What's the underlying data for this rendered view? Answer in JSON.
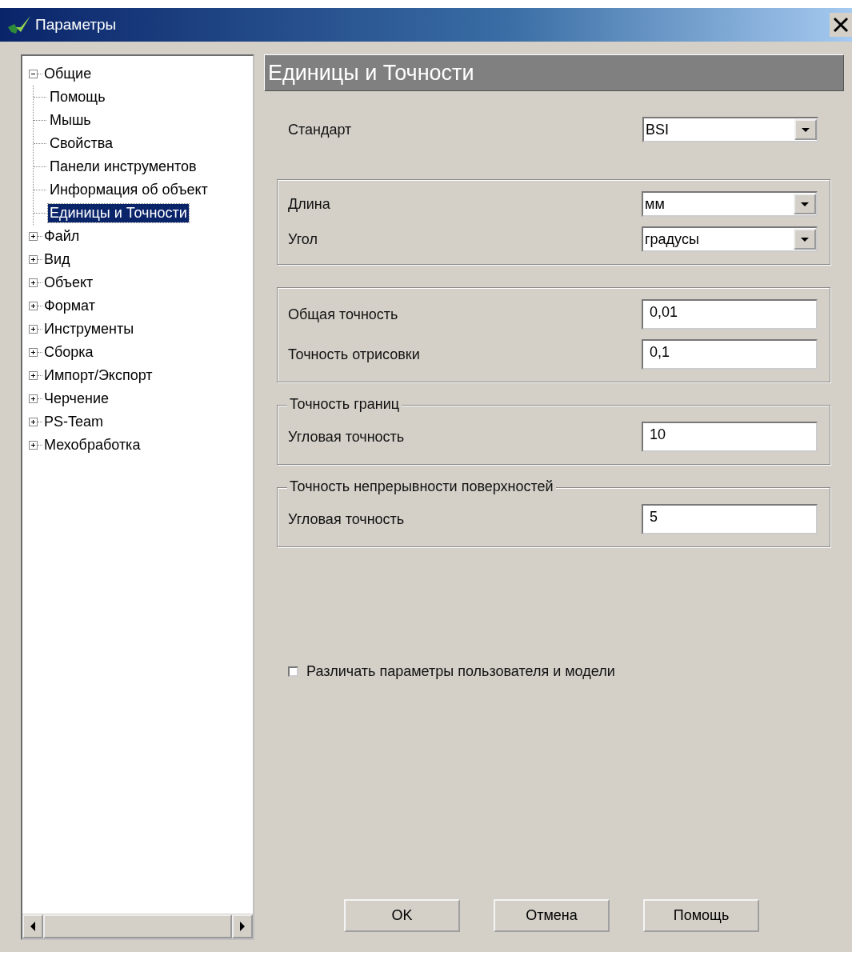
{
  "window": {
    "title": "Параметры"
  },
  "tree": {
    "items": [
      {
        "label": "Общие",
        "expanded": true,
        "selected": false,
        "children": [
          {
            "label": "Помощь",
            "selected": false
          },
          {
            "label": "Мышь",
            "selected": false
          },
          {
            "label": "Свойства",
            "selected": false
          },
          {
            "label": "Панели инструментов",
            "selected": false
          },
          {
            "label": "Информация об объект",
            "selected": false
          },
          {
            "label": "Единицы и Точности",
            "selected": true
          }
        ]
      },
      {
        "label": "Файл",
        "expanded": false,
        "selected": false
      },
      {
        "label": "Вид",
        "expanded": false,
        "selected": false
      },
      {
        "label": "Объект",
        "expanded": false,
        "selected": false
      },
      {
        "label": "Формат",
        "expanded": false,
        "selected": false
      },
      {
        "label": "Инструменты",
        "expanded": false,
        "selected": false
      },
      {
        "label": "Сборка",
        "expanded": false,
        "selected": false
      },
      {
        "label": "Импорт/Экспорт",
        "expanded": false,
        "selected": false
      },
      {
        "label": "Черчение",
        "expanded": false,
        "selected": false
      },
      {
        "label": "PS-Team",
        "expanded": false,
        "selected": false
      },
      {
        "label": "Мехобработка",
        "expanded": false,
        "selected": false
      }
    ]
  },
  "panel": {
    "title": "Единицы и Точности",
    "standard": {
      "label": "Стандарт",
      "kind": "combo",
      "value": "BSI"
    },
    "groups": [
      {
        "rows": [
          {
            "label": "Длина",
            "kind": "combo",
            "value": "мм"
          },
          {
            "label": "Угол",
            "kind": "combo",
            "value": "градусы"
          }
        ]
      },
      {
        "rows": [
          {
            "label": "Общая точность",
            "kind": "input",
            "value": "0,01"
          },
          {
            "label": "Точность отрисовки",
            "kind": "input",
            "value": "0,1"
          }
        ]
      },
      {
        "legend": "Точность границ",
        "rows": [
          {
            "label": "Угловая точность",
            "kind": "input",
            "value": "10"
          }
        ]
      },
      {
        "legend": "Точность непрерывности поверхностей",
        "rows": [
          {
            "label": "Угловая точность",
            "kind": "input",
            "value": "5"
          }
        ]
      }
    ],
    "checkbox": {
      "label": "Различать параметры пользователя и модели",
      "checked": false
    }
  },
  "buttons": [
    "OK",
    "Отмена",
    "Помощь"
  ]
}
